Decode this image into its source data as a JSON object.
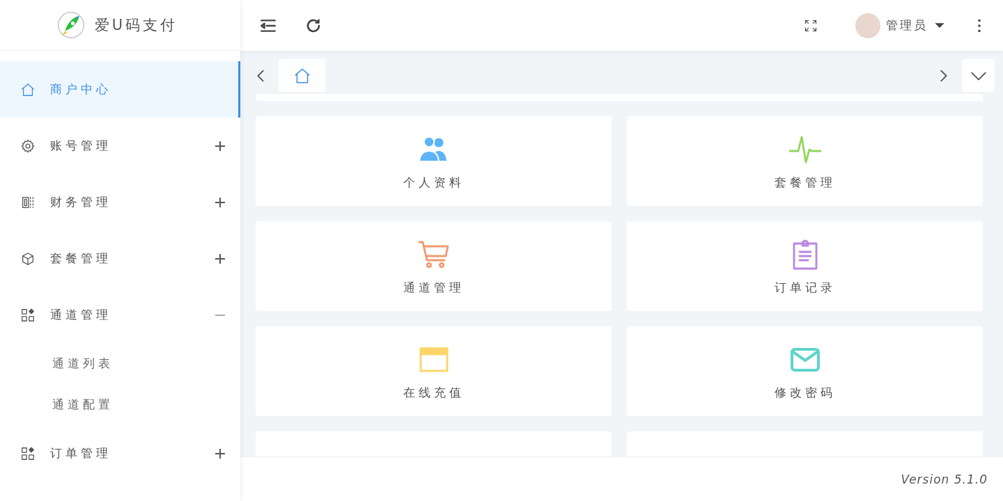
{
  "brand": {
    "name": "爱U码支付"
  },
  "sidebar": {
    "items": [
      {
        "kind": "home",
        "label": "商户中心",
        "selected": true
      },
      {
        "kind": "gear",
        "label": "账号管理",
        "selected": false,
        "expanded": false
      },
      {
        "kind": "ledger",
        "label": "财务管理",
        "selected": false,
        "expanded": false
      },
      {
        "kind": "cube",
        "label": "套餐管理",
        "selected": false,
        "expanded": false
      },
      {
        "kind": "apps",
        "label": "通道管理",
        "selected": false,
        "expanded": true,
        "children": [
          {
            "label": "通道列表",
            "selected": false
          },
          {
            "label": "通道配置",
            "selected": false
          }
        ]
      },
      {
        "kind": "apps",
        "label": "订单管理",
        "selected": false,
        "expanded": false
      }
    ]
  },
  "header": {
    "user": "管理员"
  },
  "tabs": [
    {
      "kind": "home",
      "selected": true
    }
  ],
  "cards": [
    {
      "kind": "people",
      "label": "个人资料",
      "color": "#5fb4f5"
    },
    {
      "kind": "pulse",
      "label": "套餐管理",
      "color": "#8fd65c"
    },
    {
      "kind": "cart",
      "label": "通道管理",
      "color": "#ef9a6f"
    },
    {
      "kind": "clipboard",
      "label": "订单记录",
      "color": "#b886e0"
    },
    {
      "kind": "window",
      "label": "在线充值",
      "color": "#fcd46a"
    },
    {
      "kind": "mail",
      "label": "修改密码",
      "color": "#5ed4cc"
    }
  ],
  "footer": {
    "version": "Version 5.1.0"
  }
}
